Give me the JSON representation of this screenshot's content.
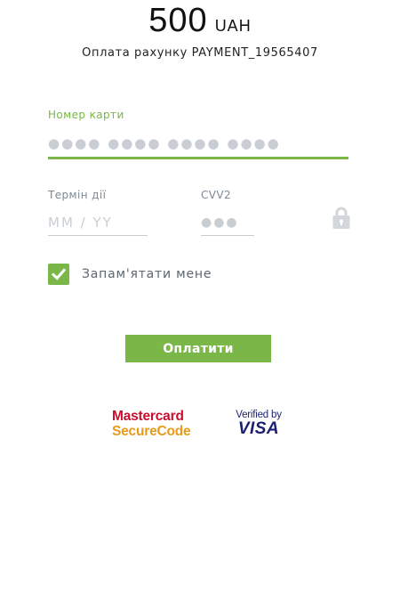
{
  "header": {
    "amount": "500",
    "currency": "UAH",
    "description": "Оплата рахунку PAYMENT_19565407"
  },
  "form": {
    "card_number": {
      "label": "Номер карти",
      "placeholder": "●●●● ●●●● ●●●● ●●●●"
    },
    "expiry": {
      "label": "Термін дії",
      "placeholder": "MM / YY"
    },
    "cvv": {
      "label": "CVV2",
      "placeholder": "●●●"
    },
    "remember_me": {
      "label": "Запам'ятати мене",
      "checked": true
    },
    "submit_label": "Оплатити"
  },
  "logos": {
    "mastercard_line1": "Mastercard",
    "mastercard_line2": "SecureCode",
    "visa_line1": "Verified by",
    "visa_line2": "VISA"
  },
  "colors": {
    "accent": "#7ab648",
    "label": "#7b8a99",
    "placeholder": "#c8ced4",
    "mastercard_red": "#c8102e",
    "mastercard_orange": "#e89b1a",
    "visa_blue": "#1a1f71"
  },
  "icons": {
    "lock": "lock-icon",
    "check": "checkmark-icon"
  }
}
